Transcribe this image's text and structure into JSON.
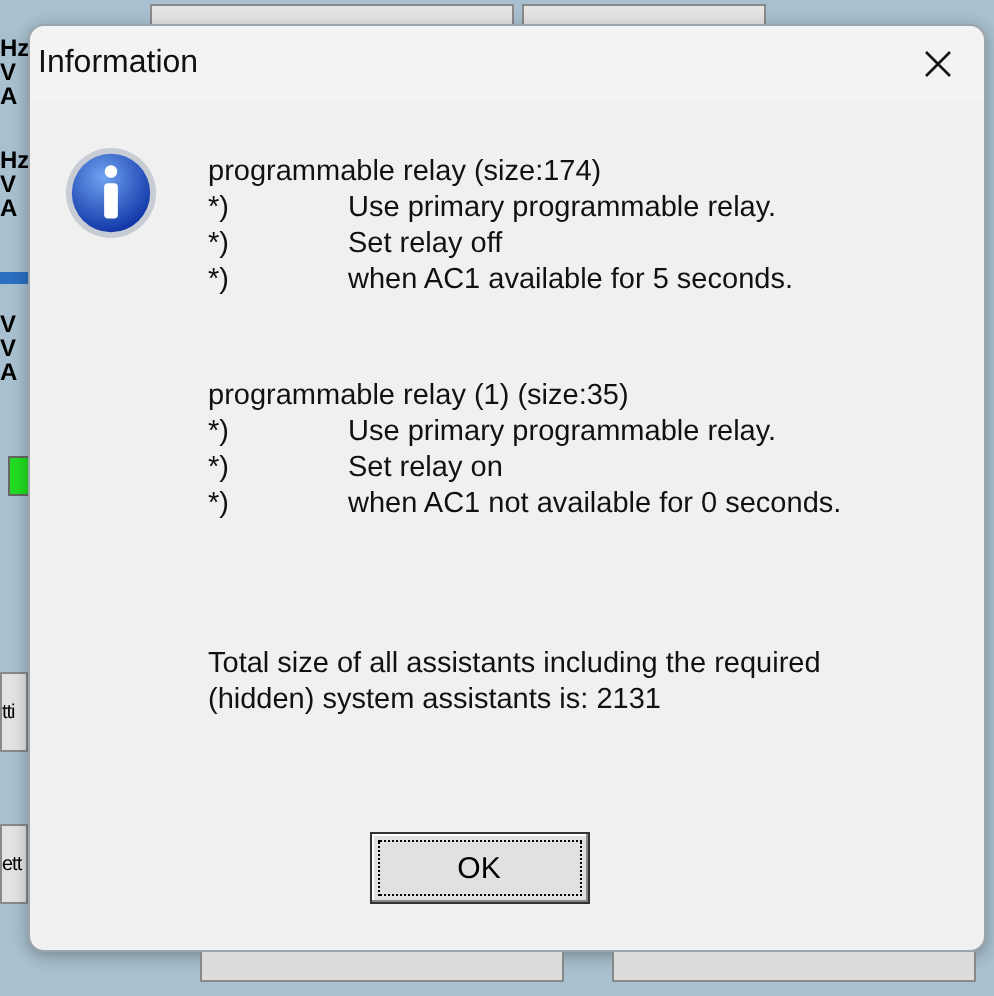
{
  "background": {
    "side_labels": [
      {
        "kind": "text",
        "text": "Hz"
      },
      {
        "kind": "text",
        "text": "V"
      },
      {
        "kind": "text",
        "text": "A"
      },
      {
        "kind": "gap"
      },
      {
        "kind": "text",
        "text": "Hz"
      },
      {
        "kind": "text",
        "text": "V"
      },
      {
        "kind": "text",
        "text": "A"
      },
      {
        "kind": "bar"
      },
      {
        "kind": "text",
        "text": "V"
      },
      {
        "kind": "text",
        "text": "V"
      },
      {
        "kind": "text",
        "text": "A"
      },
      {
        "kind": "led"
      }
    ],
    "side_buttons": [
      {
        "label": "tti"
      },
      {
        "label": "ett"
      }
    ]
  },
  "dialog": {
    "title": "Information",
    "sections": [
      {
        "heading": "programmable relay (size:174)",
        "items": [
          {
            "marker": "*)",
            "text": "Use primary programmable relay."
          },
          {
            "marker": "*)",
            "text": "Set relay off"
          },
          {
            "marker": "*)",
            "text": "when AC1 available for 5 seconds."
          }
        ]
      },
      {
        "heading": "programmable relay (1) (size:35)",
        "items": [
          {
            "marker": "*)",
            "text": "Use primary programmable relay."
          },
          {
            "marker": "*)",
            "text": "Set relay on"
          },
          {
            "marker": "*)",
            "text": "when AC1 not available for 0 seconds."
          }
        ]
      }
    ],
    "summary": "Total size of all assistants including the required (hidden) system assistants is: 2131",
    "buttons": [
      {
        "label": "OK",
        "focused": true
      }
    ]
  }
}
